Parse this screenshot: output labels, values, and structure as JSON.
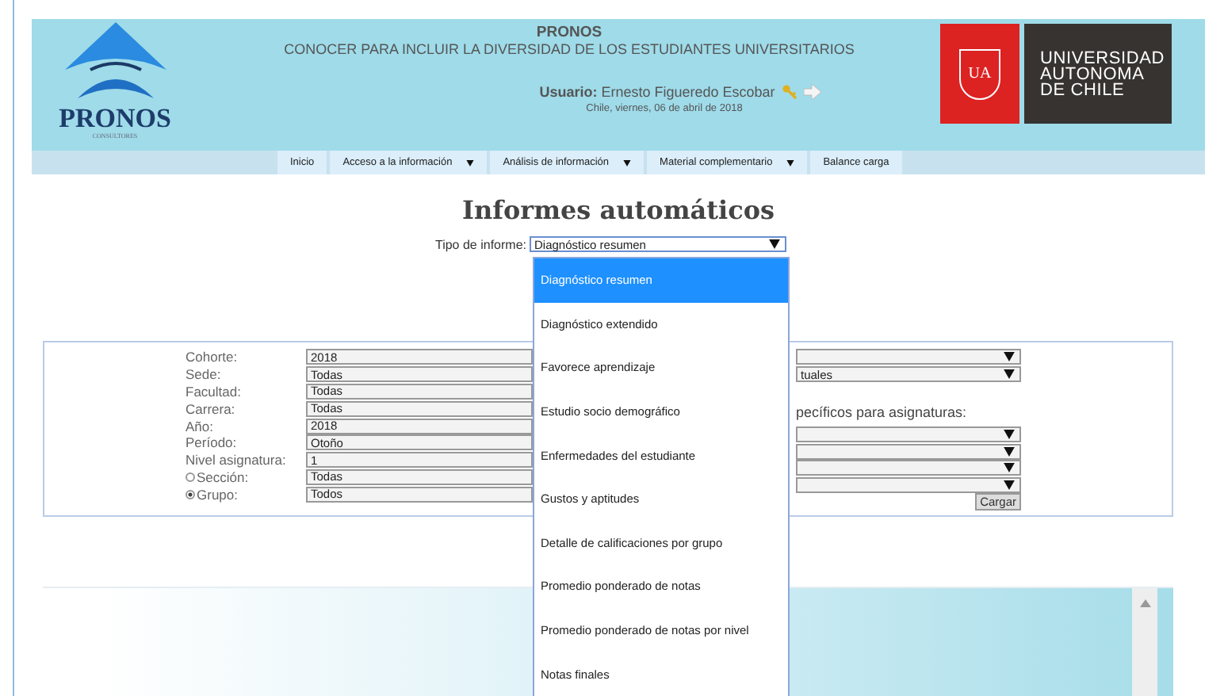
{
  "header": {
    "logo": {
      "name": "PRONOS",
      "tagline": "CONSULTORES"
    },
    "title": "PRONOS",
    "subtitle": "CONOCER PARA INCLUIR LA DIVERSIDAD DE LOS ESTUDIANTES UNIVERSITARIOS",
    "user_label": "Usuario:",
    "user_name": "Ernesto Figueredo Escobar",
    "date": "Chile, viernes, 06 de abril de 2018",
    "university": {
      "badge": "UA",
      "name": [
        "UNIVERSIDAD",
        "AUTONOMA",
        "DE CHILE"
      ]
    }
  },
  "nav": [
    {
      "label": "Inicio",
      "has_menu": false
    },
    {
      "label": "Acceso a la información",
      "has_menu": true
    },
    {
      "label": "Análisis de información",
      "has_menu": true
    },
    {
      "label": "Material complementario",
      "has_menu": true
    },
    {
      "label": "Balance carga",
      "has_menu": false
    }
  ],
  "page_title": "Informes automáticos",
  "report_type": {
    "label": "Tipo de informe:",
    "value": "Diagnóstico resumen",
    "options": [
      {
        "label": "Diagnóstico resumen",
        "selected": true
      },
      {
        "label": "Diagnóstico extendido",
        "selected": false
      },
      {
        "label": "Favorece aprendizaje",
        "selected": false
      },
      {
        "label": "Estudio socio demográfico",
        "selected": false
      },
      {
        "label": "Enfermedades del estudiante",
        "selected": false
      },
      {
        "label": "Gustos y aptitudes",
        "selected": false
      },
      {
        "label": "Detalle de calificaciones por grupo",
        "selected": false
      },
      {
        "label": "Promedio ponderado de notas",
        "selected": false
      },
      {
        "label": "Promedio ponderado de notas por nivel",
        "selected": false
      },
      {
        "label": "Notas finales",
        "selected": false
      }
    ]
  },
  "filters": [
    {
      "kind": "select",
      "label": "Cohorte:",
      "value": "2018"
    },
    {
      "kind": "select",
      "label": "Sede:",
      "value": "Todas"
    },
    {
      "kind": "select",
      "label": "Facultad:",
      "value": "Todas"
    },
    {
      "kind": "select",
      "label": "Carrera:",
      "value": "Todas"
    },
    {
      "kind": "select",
      "label": "Año:",
      "value": "2018"
    },
    {
      "kind": "select",
      "label": "Período:",
      "value": "Otoño"
    },
    {
      "kind": "select",
      "label": "Nivel asignatura:",
      "value": "1"
    },
    {
      "kind": "radio",
      "label": "Sección:",
      "value": "Todas",
      "selected": false
    },
    {
      "kind": "radio",
      "label": "Grupo:",
      "value": "Todos",
      "selected": true
    }
  ],
  "right_panel": [
    {
      "kind": "select"
    },
    {
      "kind": "select",
      "value": "tuales"
    },
    {
      "kind": "blank"
    },
    {
      "kind": "label",
      "text": "pecíficos para asignaturas:"
    },
    {
      "kind": "select"
    },
    {
      "kind": "select"
    },
    {
      "kind": "select"
    },
    {
      "kind": "select"
    },
    {
      "kind": "button",
      "text": "Cargar"
    }
  ]
}
